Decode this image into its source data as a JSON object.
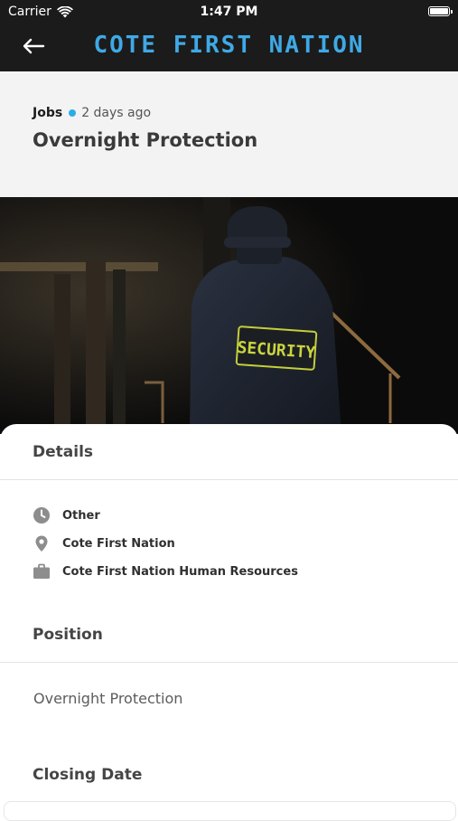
{
  "status_bar": {
    "carrier": "Carrier",
    "time": "1:47 PM"
  },
  "header": {
    "app_title": "COTE FIRST NATION",
    "back_icon": "arrow-left-icon",
    "title_color": "#3fa9e6"
  },
  "job": {
    "category": "Jobs",
    "posted": "2 days ago",
    "title": "Overnight Protection",
    "badge_color": "#29aee6",
    "image_text": "SECURITY"
  },
  "details": {
    "heading": "Details",
    "items": [
      {
        "icon": "clock-icon",
        "label": "Other"
      },
      {
        "icon": "location-pin-icon",
        "label": "Cote First Nation"
      },
      {
        "icon": "briefcase-icon",
        "label": "Cote First Nation Human Resources"
      }
    ]
  },
  "position": {
    "heading": "Position",
    "value": "Overnight Protection"
  },
  "closing_date": {
    "heading": "Closing Date"
  }
}
